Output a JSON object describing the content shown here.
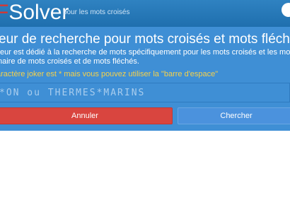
{
  "header": {
    "brand_prefix": "F",
    "brand_name": "Solver",
    "tagline": "pour les mots croisés",
    "accent_color": "#e0342a",
    "bar_color": "#2573b4"
  },
  "main": {
    "heading": "eur de recherche pour mots croisés et mots fléchés",
    "description_line1": "teur est dédié à la recherche de mots spécifiquement pour les mots croisés et les mo",
    "description_line2": "naire de mots croisés et de mots fléchés.",
    "hint": "aractère joker est * mais vous pouvez utiliser la \"barre d'espace\"",
    "hint_color": "#f6d14a",
    "band_color": "#3f8fd5"
  },
  "search": {
    "placeholder": "*ON ou THERMES*MARINS",
    "value": ""
  },
  "buttons": {
    "cancel_label": "Annuler",
    "cancel_color": "#d9453f",
    "search_label": "Chercher",
    "search_color": "#4b92dd"
  }
}
